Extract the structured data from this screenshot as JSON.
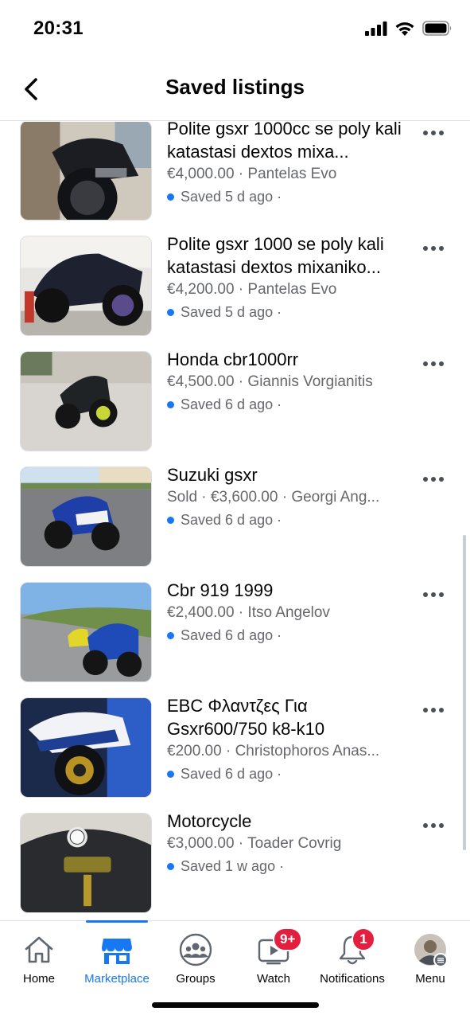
{
  "status_bar": {
    "time": "20:31"
  },
  "header": {
    "title": "Saved listings"
  },
  "listings": [
    {
      "title": "Polite gsxr 1000cc se poly kali katastasi dextos mixa...",
      "meta": "€4,000.00 · Pantelas Evo",
      "saved": "Saved 5 d ago ·"
    },
    {
      "title": "Polite gsxr 1000 se poly kali katastasi dextos mixaniko...",
      "meta": "€4,200.00 · Pantelas Evo",
      "saved": "Saved 5 d ago ·"
    },
    {
      "title": "Honda cbr1000rr",
      "meta": "€4,500.00 · Giannis Vorgianitis",
      "saved": "Saved 6 d ago ·"
    },
    {
      "title": "Suzuki gsxr",
      "meta": "Sold · €3,600.00 · Georgi Ang...",
      "saved": "Saved 6 d ago ·"
    },
    {
      "title": "Cbr 919 1999",
      "meta": "€2,400.00 · Itso Angelov",
      "saved": "Saved 6 d ago ·"
    },
    {
      "title": "EBC Φλαντζες Για Gsxr600/750 k8-k10",
      "meta": "€200.00 · Christophoros Anas...",
      "saved": "Saved 6 d ago ·"
    },
    {
      "title": "Motorcycle",
      "meta": "€3,000.00 · Toader Covrig",
      "saved": "Saved 1 w ago ·"
    }
  ],
  "tabs": [
    {
      "label": "Home",
      "icon": "home-icon"
    },
    {
      "label": "Marketplace",
      "icon": "marketplace-icon",
      "active": true
    },
    {
      "label": "Groups",
      "icon": "groups-icon"
    },
    {
      "label": "Watch",
      "icon": "watch-icon",
      "badge": "9+"
    },
    {
      "label": "Notifications",
      "icon": "bell-icon",
      "badge": "1"
    },
    {
      "label": "Menu",
      "icon": "avatar-menu-icon"
    }
  ],
  "colors": {
    "accent": "#1877f2",
    "badge": "#e41e3f",
    "secondary_text": "#65676b"
  }
}
